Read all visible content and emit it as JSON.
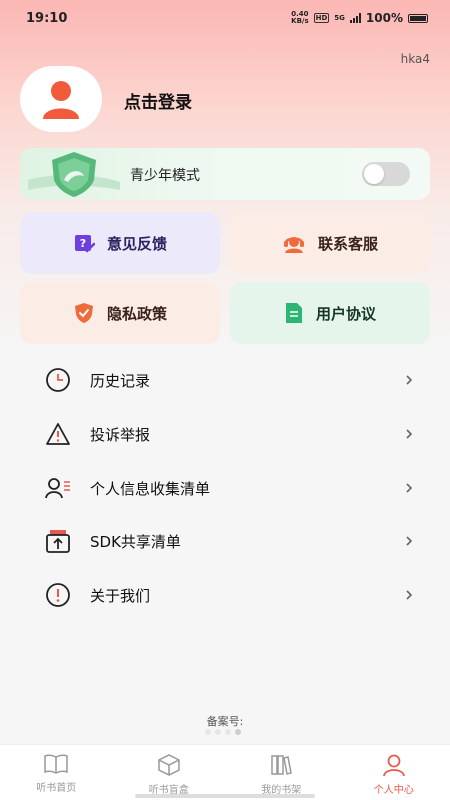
{
  "status_bar": {
    "time": "19:10",
    "net_speed_value": "0.40",
    "net_speed_unit": "KB/s",
    "hd_badge": "HD",
    "network": "5G",
    "battery_text": "100%"
  },
  "profile": {
    "version": "hka4",
    "login_label": "点击登录"
  },
  "teen_mode": {
    "label": "青少年模式",
    "enabled": false
  },
  "quick_cards": [
    {
      "label": "意见反馈",
      "icon": "feedback-edit-icon",
      "color": "#6b3fe0"
    },
    {
      "label": "联系客服",
      "icon": "customer-service-icon",
      "color": "#f06b3c"
    },
    {
      "label": "隐私政策",
      "icon": "privacy-shield-icon",
      "color": "#f06b3c"
    },
    {
      "label": "用户协议",
      "icon": "document-icon",
      "color": "#2bb673"
    }
  ],
  "menu": [
    {
      "label": "历史记录",
      "icon": "clock-icon"
    },
    {
      "label": "投诉举报",
      "icon": "warning-icon"
    },
    {
      "label": "个人信息收集清单",
      "icon": "person-list-icon"
    },
    {
      "label": "SDK共享清单",
      "icon": "share-box-icon"
    },
    {
      "label": "关于我们",
      "icon": "info-icon"
    }
  ],
  "footer": {
    "beian": "备案号:"
  },
  "tabs": [
    {
      "label": "听书首页",
      "icon": "book-open-icon",
      "active": false
    },
    {
      "label": "听书盲盒",
      "icon": "box-icon",
      "active": false
    },
    {
      "label": "我的书架",
      "icon": "bookshelf-icon",
      "active": false
    },
    {
      "label": "个人中心",
      "icon": "person-icon",
      "active": true
    }
  ],
  "colors": {
    "accent": "#e85a50",
    "header_gradient_top": "#fbb7b4"
  }
}
